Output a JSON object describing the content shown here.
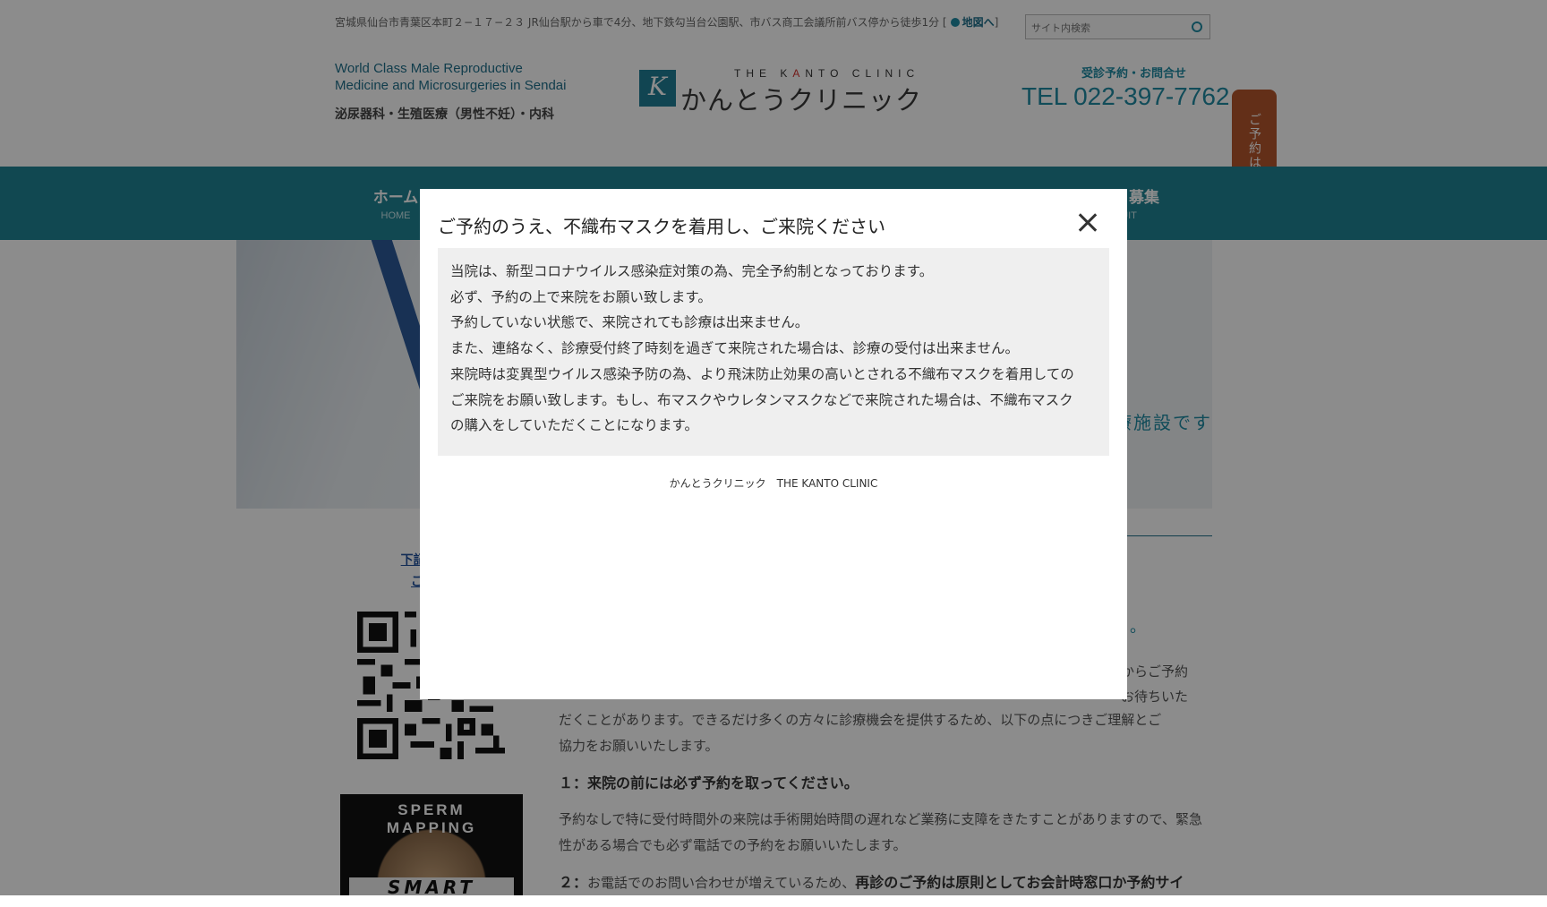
{
  "header": {
    "address": "宮城県仙台市青葉区本町２−１７−２３ JR仙台駅から車で4分、地下鉄勾当台公園駅、市バス商工会議所前バス停から徒歩1分 [",
    "map_link": "地図へ",
    "address_end": "]",
    "search_placeholder": "サイト内検索",
    "tagline_line1": "World Class Male Reproductive",
    "tagline_line2": "Medicine and Microsurgeries in Sendai",
    "specialty": "泌尿器科・生殖医療（男性不妊）・内科",
    "logo_en_pre": "THE K",
    "logo_en_red": "A",
    "logo_en_post": "NTO CLINIC",
    "logo_jp": "かんとうクリニック",
    "reserve_label": "受診予約・お問合せ",
    "tel": "TEL 022-397-7762",
    "side_tab": "ご予約はこちらから"
  },
  "nav": {
    "items": [
      {
        "jp": "ホーム",
        "en": "HOME"
      },
      {
        "jp": "",
        "en": ""
      },
      {
        "jp": "",
        "en": ""
      },
      {
        "jp": "",
        "en": ""
      },
      {
        "jp": "",
        "en": ""
      },
      {
        "jp": "ッフ募集",
        "en": "UIT"
      }
    ]
  },
  "hero": {
    "text_fragment": "療施設です"
  },
  "left": {
    "qr_caption_line1": "下記QRコ",
    "qr_caption_line2": "ご予約",
    "sperm_title": "SPERM MAPPING",
    "sperm_sub": "SMART"
  },
  "main": {
    "frag_dot": "。",
    "frag_right": "からご予約",
    "frag_right2": "お待ちいた",
    "para1_line2": "だくことがあります。できるだけ多くの方々に診療機会を提供するため、以下の点につきご理解とご",
    "para1_line3": "協力をお願いいたします。",
    "heading1": "１：来院の前には必ず予約を取ってください。",
    "para2": "予約なしで特に受付時間外の来院は手術開始時間の遅れなど業務に支障をきたすことがありますので、緊急性がある場合でも必ず電話での予約をお願いいたします。",
    "heading2_prefix": "２：",
    "heading2_normal": "お電話でのお問い合わせが増えているため、",
    "heading2_bold": "再診のご予約は原則としてお会計時窓口か予約サイ"
  },
  "modal": {
    "title": "ご予約のうえ、不織布マスクを着用し、ご来院ください",
    "lines": [
      "当院は、新型コロナウイルス感染症対策の為、完全予約制となっております。",
      "必ず、予約の上で来院をお願い致します。",
      "予約していない状態で、来院されても診療は出来ません。",
      "また、連絡なく、診療受付終了時刻を過ぎて来院された場合は、診療の受付は出来ません。",
      "来院時は変異型ウイルス感染予防の為、より飛沫防止効果の高いとされる不織布マスクを着用しての",
      "ご来院をお願い致します。もし、布マスクやウレタンマスクなどで来院された場合は、不織布マスク",
      "の購入をしていただくことになります。"
    ],
    "footer": "かんとうクリニック　THE KANTO CLINIC"
  },
  "colors": {
    "brand_teal": "#1f8494",
    "link_teal": "#1f8aa3",
    "tab_orange": "#b4562c",
    "overlay": "rgba(0,0,0,0.45)"
  },
  "icons": [
    "search-icon",
    "map-pin-icon",
    "close-icon",
    "logo-k-icon"
  ]
}
